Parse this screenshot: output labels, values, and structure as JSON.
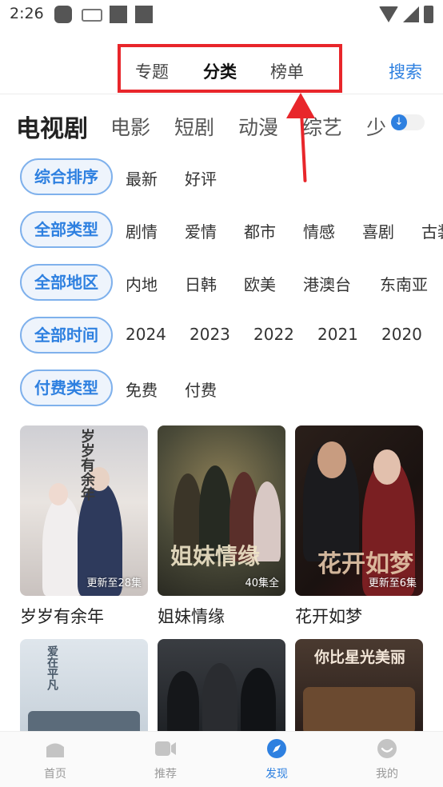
{
  "status": {
    "time": "2:26"
  },
  "top_tabs": [
    {
      "label": "专题"
    },
    {
      "label": "分类"
    },
    {
      "label": "榜单"
    }
  ],
  "search_label": "搜索",
  "categories": [
    {
      "label": "电视剧"
    },
    {
      "label": "电影"
    },
    {
      "label": "短剧"
    },
    {
      "label": "动漫"
    },
    {
      "label": "综艺"
    },
    {
      "label": "少"
    }
  ],
  "filters": {
    "sort": {
      "label": "综合排序",
      "options": [
        "最新",
        "好评"
      ]
    },
    "type": {
      "label": "全部类型",
      "options": [
        "剧情",
        "爱情",
        "都市",
        "情感",
        "喜剧",
        "古装"
      ]
    },
    "region": {
      "label": "全部地区",
      "options": [
        "内地",
        "日韩",
        "欧美",
        "港澳台",
        "东南亚"
      ]
    },
    "year": {
      "label": "全部时间",
      "options": [
        "2024",
        "2023",
        "2022",
        "2021",
        "2020"
      ]
    },
    "pay": {
      "label": "付费类型",
      "options": [
        "免费",
        "付费"
      ]
    }
  },
  "cards": [
    {
      "title": "岁岁有余年",
      "badge": "更新至28集",
      "poster_text": "岁岁有余年",
      "bg": "#d9d6d6"
    },
    {
      "title": "姐妹情缘",
      "badge": "40集全",
      "poster_text": "姐妹情缘",
      "bg": "#4a4a38"
    },
    {
      "title": "花开如梦",
      "badge": "更新至6集",
      "poster_text": "花开如梦",
      "bg": "#1e1512"
    }
  ],
  "cards_row2": [
    {
      "poster_text": "爱在平凡",
      "bg": "#dfe6ec"
    },
    {
      "poster_text": "",
      "bg": "#2b2e33"
    },
    {
      "poster_text": "你比星光美丽",
      "bg": "#3b2a24"
    }
  ],
  "bottom_nav": [
    {
      "label": "首页"
    },
    {
      "label": "推荐"
    },
    {
      "label": "发现"
    },
    {
      "label": "我的"
    }
  ],
  "colors": {
    "accent": "#2e80e0",
    "annotation": "#e8262b"
  }
}
